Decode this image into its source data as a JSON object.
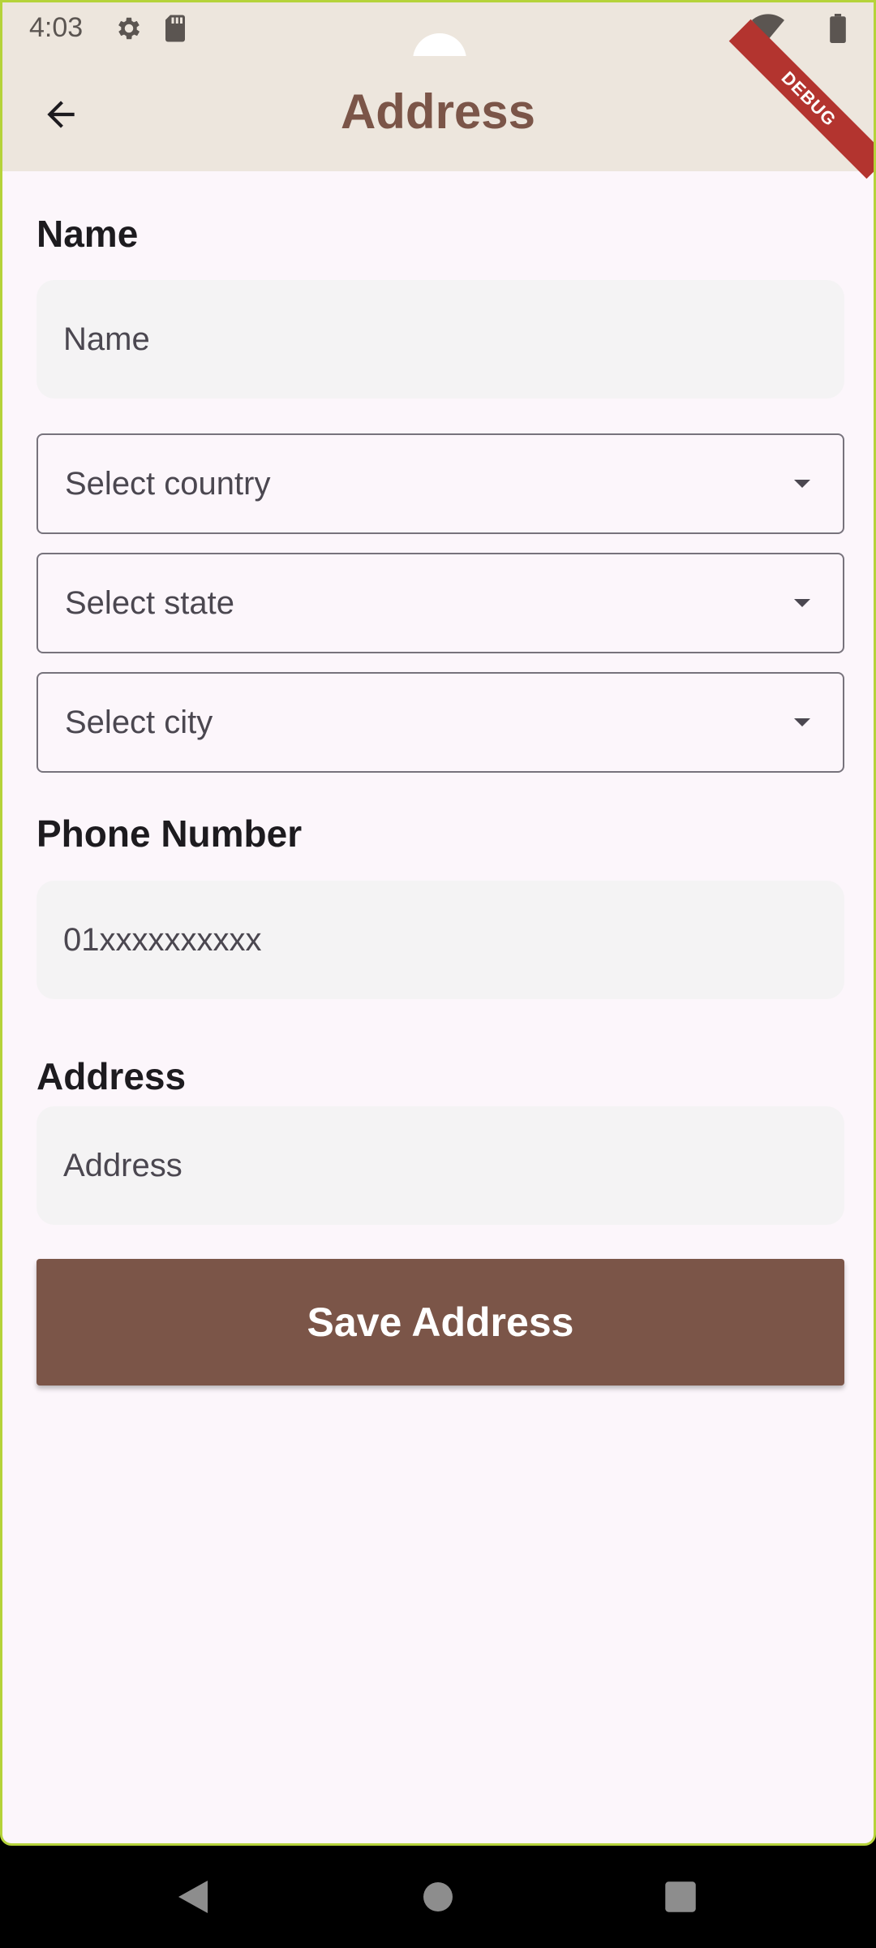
{
  "status_bar": {
    "time": "4:03",
    "icons": [
      "gear-icon",
      "sd-card-icon",
      "wifi-icon",
      "battery-icon"
    ]
  },
  "app_bar": {
    "title": "Address",
    "back_icon": "arrow-back-icon",
    "debug_banner": "DEBUG"
  },
  "form": {
    "name_label": "Name",
    "name_placeholder": "Name",
    "country_placeholder": "Select country",
    "state_placeholder": "Select state",
    "city_placeholder": "Select city",
    "phone_label": "Phone Number",
    "phone_placeholder": "01xxxxxxxxxx",
    "address_label": "Address",
    "address_placeholder": "Address",
    "save_label": "Save Address"
  },
  "colors": {
    "brand_brown": "#7b5548",
    "app_bar_bg": "#ede6dd",
    "page_bg": "#fcf6fb",
    "field_bg": "#f4f3f4",
    "debug_red": "#b3342f"
  },
  "nav_bar": {
    "icons": [
      "back-triangle-icon",
      "home-circle-icon",
      "recents-square-icon"
    ]
  }
}
